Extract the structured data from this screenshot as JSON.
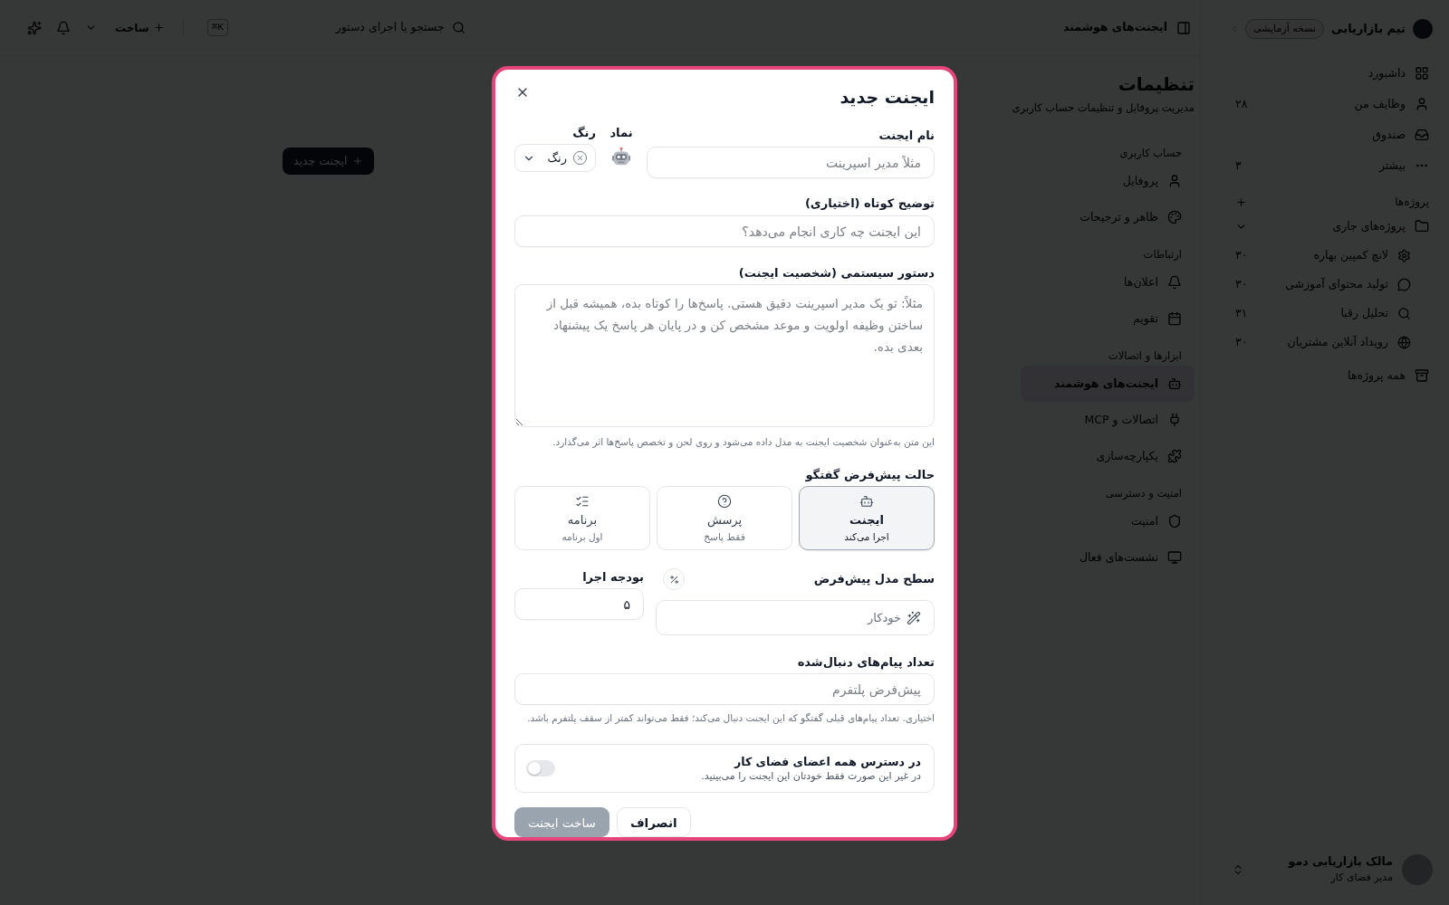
{
  "sidebar": {
    "workspace": {
      "name": "تیم بازاریابی",
      "badge": "نسخه آزمایشی"
    },
    "items": [
      {
        "label": "داشبورد"
      },
      {
        "label": "وظایف من",
        "count": "۲۸"
      },
      {
        "label": "صندوق"
      },
      {
        "label": "بیشتر",
        "count": "۳"
      }
    ],
    "projects": {
      "label": "پروژه‌ها",
      "groups": [
        {
          "label": "پروژه‌های جاری",
          "expanded": true,
          "children": [
            {
              "label": "لانچ کمپین بهاره",
              "count": "۳۰"
            },
            {
              "label": "تولید محتوای آموزشی",
              "count": "۳۰"
            },
            {
              "label": "تحلیل رقبا",
              "count": "۳۱"
            },
            {
              "label": "رویداد آنلاین مشتریان",
              "count": "۳۰"
            }
          ]
        }
      ],
      "all": "همه پروژه‌ها"
    },
    "user": {
      "name": "مالک بازاریابی دمو",
      "status": "مدیر فضای کار"
    }
  },
  "top_bar": {
    "breadcrumb": "ایجنت‌های هوشمند",
    "search": {
      "placeholder": "جستجو یا اجرای دستور",
      "shortcut": "⌘K"
    },
    "create_button": "ساخت"
  },
  "settings": {
    "title": "تنظیمات",
    "subtitle": "مدیریت پروفایل و تنظیمات حساب کاربری",
    "sections": [
      {
        "label": "حساب کاربری",
        "items": [
          {
            "label": "پروفایل",
            "selected": false
          },
          {
            "label": "ظاهر و ترجیحات",
            "selected": false
          }
        ]
      },
      {
        "label": "ارتباطات",
        "items": [
          {
            "label": "اعلان‌ها",
            "selected": false
          },
          {
            "label": "تقویم",
            "selected": false
          }
        ]
      },
      {
        "label": "ابزارها و اتصالات",
        "items": [
          {
            "label": "ایجنت‌های هوشمند",
            "selected": true
          },
          {
            "label": "اتصالات و MCP",
            "selected": false
          },
          {
            "label": "یکپارچه‌سازی",
            "selected": false
          }
        ]
      },
      {
        "label": "امنیت و دسترسی",
        "items": [
          {
            "label": "امنیت",
            "selected": false
          },
          {
            "label": "نشست‌های فعال",
            "selected": false
          }
        ]
      }
    ],
    "new_agent_button": "ایجنت جدید"
  },
  "dialog": {
    "title": "ایجنت جدید",
    "name_field": {
      "label": "نام ایجنت",
      "placeholder": "مثلاً مدیر اسپرینت"
    },
    "symbol": {
      "label": "نماد"
    },
    "color": {
      "label": "رنگ",
      "value": "رنگ"
    },
    "description_field": {
      "label": "توضیح کوتاه (اختیاری)",
      "placeholder": "این ایجنت چه کاری انجام می‌دهد؟"
    },
    "system_prompt": {
      "label": "دستور سیستمی (شخصیت ایجنت)",
      "placeholder": "مثلاً: تو یک مدیر اسپرینت دقیق هستی. پاسخ‌ها را کوتاه بده، همیشه قبل از ساختن وظیفه اولویت و موعد مشخص کن و در پایان هر پاسخ یک پیشنهاد بعدی بده.",
      "help": "این متن به‌عنوان شخصیت ایجنت به مدل داده می‌شود و روی لحن و تخصص پاسخ‌ها اثر می‌گذارد."
    },
    "mode": {
      "label": "حالت پیش‌فرض گفتگو",
      "options": [
        {
          "title": "ایجنت",
          "subtitle": "اجرا می‌کند",
          "selected": true
        },
        {
          "title": "پرسش",
          "subtitle": "فقط پاسخ",
          "selected": false
        },
        {
          "title": "برنامه",
          "subtitle": "اول برنامه",
          "selected": false
        }
      ]
    },
    "model_level": {
      "label": "سطح مدل پیش‌فرض",
      "value": "خودکار"
    },
    "budget": {
      "label": "بودجه اجرا",
      "value": "۵"
    },
    "tracked_messages": {
      "label": "تعداد پیام‌های دنبال‌شده",
      "placeholder": "پیش‌فرض پلتفرم",
      "help": "اختیاری. تعداد پیام‌های قبلی گفتگو که این ایجنت دنبال می‌کند؛ فقط می‌تواند کمتر از سقف پلتفرم باشد."
    },
    "shared": {
      "title": "در دسترس همه اعضای فضای کار",
      "description": "در غیر این صورت فقط خودتان این ایجنت را می‌بینید.",
      "on": false
    },
    "buttons": {
      "cancel": "انصراف",
      "submit": {
        "label": "ساخت ایجنت",
        "disabled": true
      }
    }
  }
}
